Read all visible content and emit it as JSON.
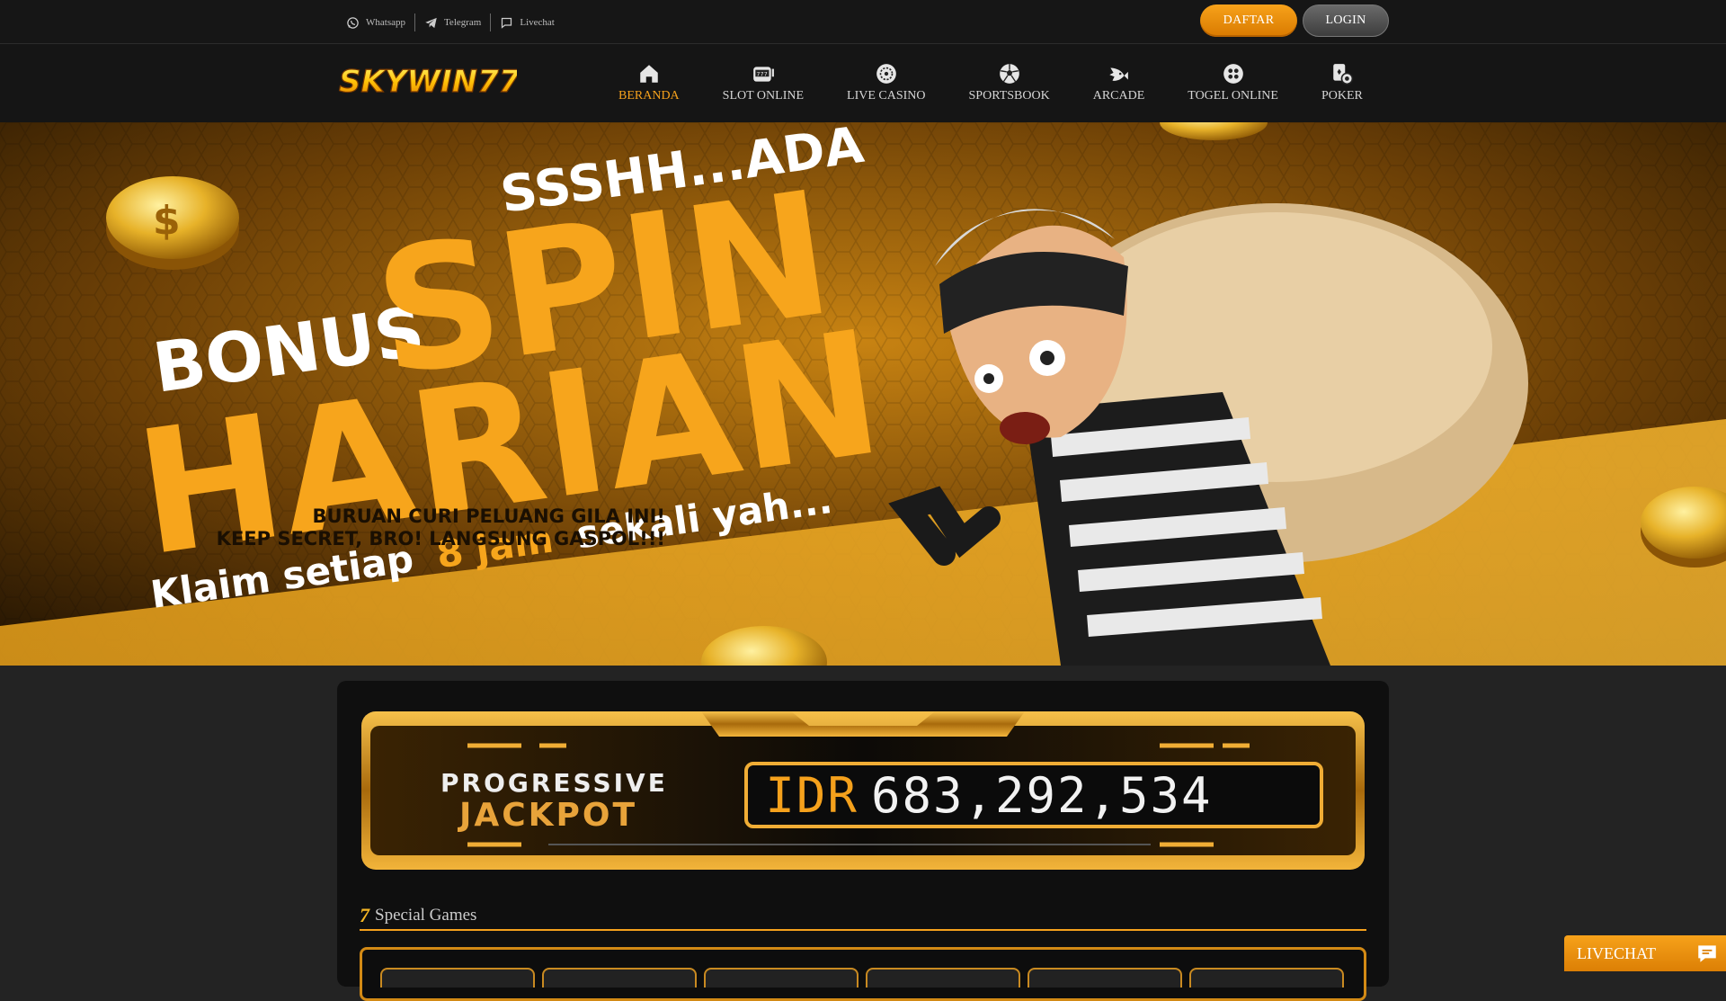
{
  "topbar": {
    "contacts": [
      {
        "label": "Whatsapp",
        "icon": "whatsapp-icon"
      },
      {
        "label": "Telegram",
        "icon": "telegram-icon"
      },
      {
        "label": "Livechat",
        "icon": "chat-bubble-icon"
      }
    ],
    "register_label": "DAFTAR",
    "login_label": "LOGIN"
  },
  "brand": {
    "logo_text": "SKYWIN77"
  },
  "nav": {
    "items": [
      {
        "label": "BERANDA",
        "icon": "home-icon",
        "active": true
      },
      {
        "label": "SLOT ONLINE",
        "icon": "slot-machine-icon"
      },
      {
        "label": "LIVE CASINO",
        "icon": "roulette-icon"
      },
      {
        "label": "SPORTSBOOK",
        "icon": "soccer-ball-icon"
      },
      {
        "label": "ARCADE",
        "icon": "fish-icon"
      },
      {
        "label": "TOGEL ONLINE",
        "icon": "lottery-balls-icon"
      },
      {
        "label": "POKER",
        "icon": "poker-chip-icon"
      }
    ]
  },
  "banner": {
    "line_top": "SSSHH...ADA",
    "line_bonus": "BONUS",
    "line_spin": "SPIN",
    "line_harian": "HARIAN",
    "line_claim_a": "Klaim setiap",
    "line_claim_b": "8 jam",
    "line_claim_c": "sekali yah...",
    "line_cta1": "BURUAN CURI PELUANG GILA INI!",
    "line_cta2": "KEEP SECRET, BRO! LANGSUNG GASPOL!!!"
  },
  "jackpot": {
    "label_line1": "PROGRESSIVE",
    "label_line2": "JACKPOT",
    "currency": "IDR",
    "amount": "683,292,534"
  },
  "special": {
    "title": "Special Games"
  },
  "livechat": {
    "label": "LIVECHAT"
  },
  "colors": {
    "accent": "#f5a11c",
    "background": "#232323",
    "panel": "#0f0f0f"
  }
}
